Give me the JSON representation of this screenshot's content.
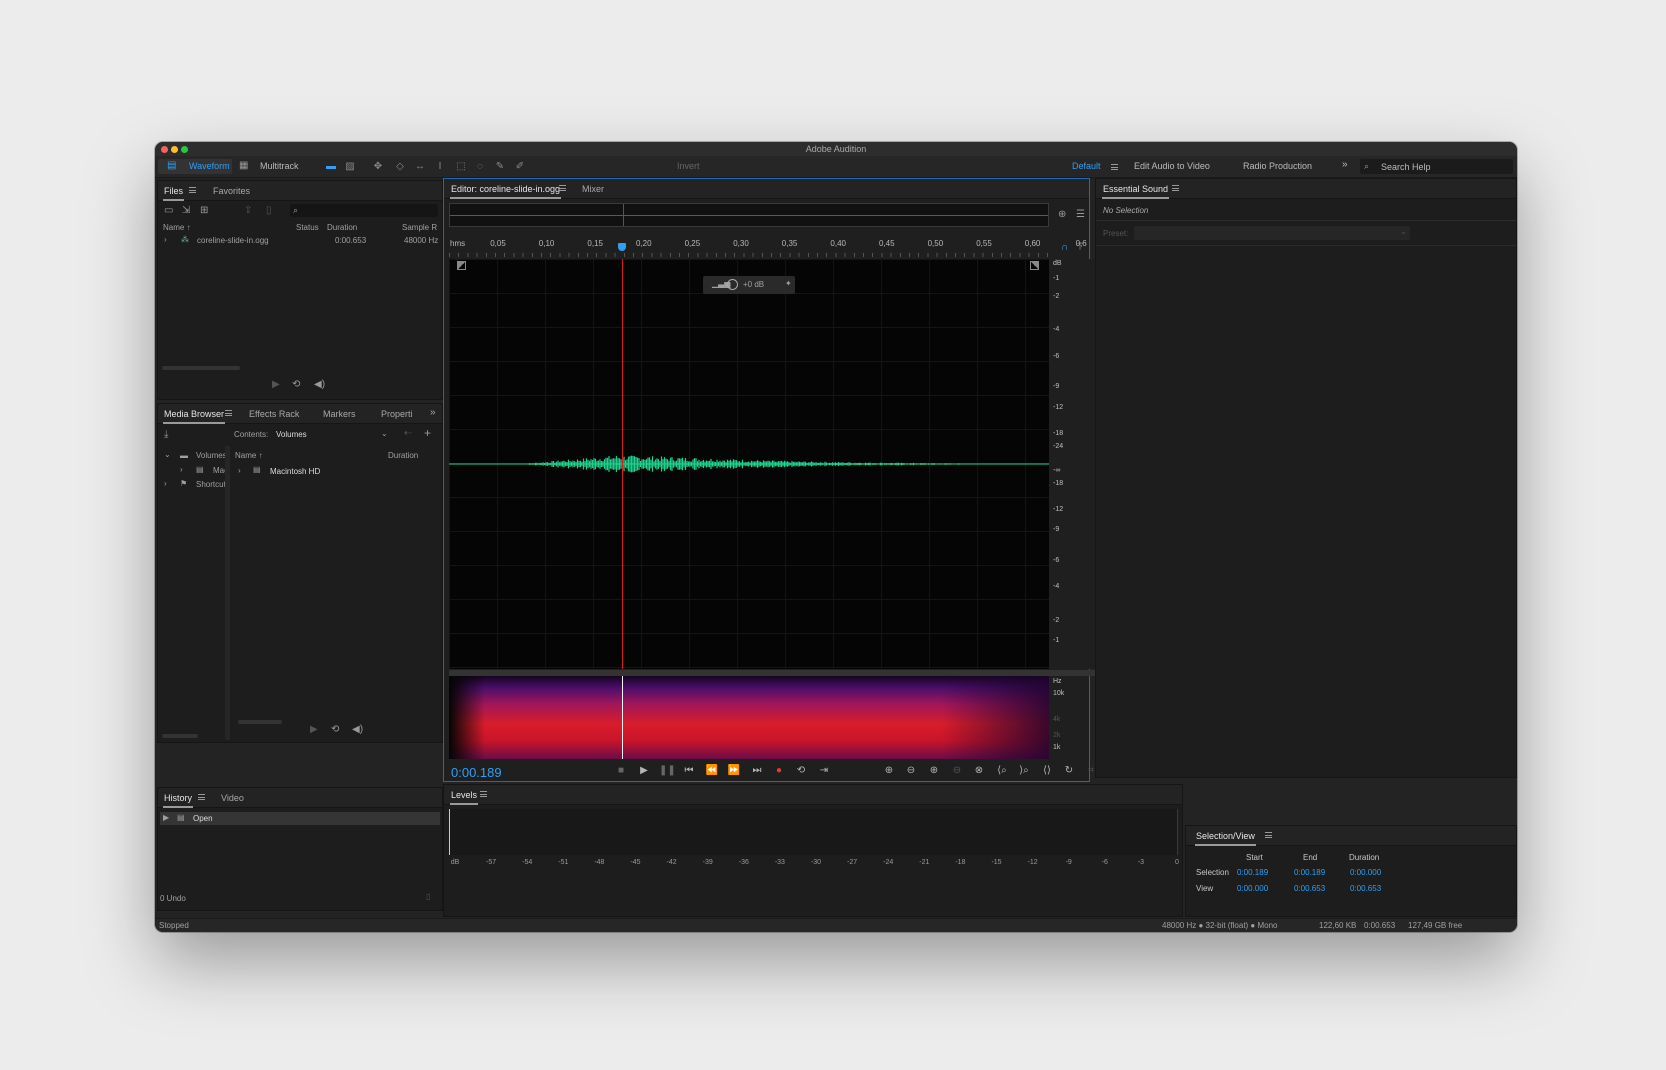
{
  "app": {
    "title": "Adobe Audition",
    "status_left": "Stopped",
    "status_right": [
      "48000 Hz ● 32-bit (float) ● Mono",
      "122,60 KB",
      "0:00.653",
      "127,49 GB free"
    ]
  },
  "toolbar": {
    "waveform_label": "Waveform",
    "multitrack_label": "Multitrack",
    "invert_label": "Invert",
    "workspaces": [
      "Default",
      "Edit Audio to Video",
      "Radio Production"
    ],
    "search_placeholder": "Search Help"
  },
  "files_panel": {
    "tabs": [
      "Files",
      "Favorites"
    ],
    "columns": [
      "Name ↑",
      "Status",
      "Duration",
      "Sample R"
    ],
    "rows": [
      {
        "name": "coreline-slide-in.ogg",
        "status": "",
        "duration": "0:00.653",
        "sample_rate": "48000 Hz"
      }
    ]
  },
  "media_browser": {
    "tabs": [
      "Media Browser",
      "Effects Rack",
      "Markers",
      "Properti"
    ],
    "contents_label": "Contents:",
    "contents_value": "Volumes",
    "tree": [
      "Volumes",
      "Mac",
      "Shortcut"
    ],
    "columns": [
      "Name ↑",
      "Duration"
    ],
    "items": [
      "Macintosh HD"
    ]
  },
  "history": {
    "tabs": [
      "History",
      "Video"
    ],
    "items": [
      "Open"
    ],
    "undo_count": "0 Undo"
  },
  "editor": {
    "tab_label": "Editor: coreline-slide-in.ogg",
    "mixer_label": "Mixer",
    "ruler_unit": "hms",
    "ruler_ticks": [
      "0,05",
      "0,10",
      "0,15",
      "0,20",
      "0,25",
      "0,30",
      "0,35",
      "0,40",
      "0,45",
      "0,50",
      "0,55",
      "0,60",
      "0,6"
    ],
    "db_unit": "dB",
    "db_scale_top": [
      "-1",
      "-2",
      "-4",
      "-6",
      "-9",
      "-12",
      "-18",
      "-24"
    ],
    "db_center": "-∞",
    "db_scale_bottom": [
      "-18",
      "-12",
      "-9",
      "-6",
      "-4",
      "-2",
      "-1"
    ],
    "hud_gain": "+0 dB",
    "hz_unit": "Hz",
    "hz_scale": [
      "10k",
      "4k",
      "2k",
      "1k"
    ],
    "playhead_time": "0:00.189",
    "playhead_fraction": 0.289
  },
  "essential_sound": {
    "title": "Essential Sound",
    "no_selection": "No Selection",
    "preset_label": "Preset:"
  },
  "levels": {
    "title": "Levels",
    "scale": [
      "dB",
      "-57",
      "-54",
      "-51",
      "-48",
      "-45",
      "-42",
      "-39",
      "-36",
      "-33",
      "-30",
      "-27",
      "-24",
      "-21",
      "-18",
      "-15",
      "-12",
      "-9",
      "-6",
      "-3",
      "0"
    ]
  },
  "selection_view": {
    "title": "Selection/View",
    "headers": [
      "Start",
      "End",
      "Duration"
    ],
    "selection": {
      "label": "Selection",
      "start": "0:00.189",
      "end": "0:00.189",
      "duration": "0:00.000"
    },
    "view": {
      "label": "View",
      "start": "0:00.000",
      "end": "0:00.653",
      "duration": "0:00.653"
    }
  },
  "colors": {
    "accent": "#2e9ff5",
    "waveform": "#1fd38f",
    "playhead": "#d22020",
    "record": "#e03a3a"
  }
}
